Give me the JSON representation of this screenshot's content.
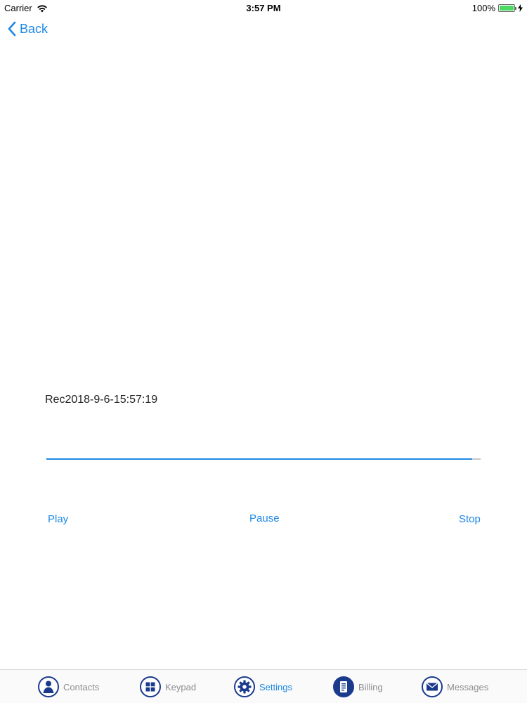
{
  "status_bar": {
    "carrier": "Carrier",
    "time": "3:57 PM",
    "battery": "100%",
    "battery_level": 1.0
  },
  "nav": {
    "back_label": "Back"
  },
  "recording": {
    "name": "Rec2018-9-6-15:57:19",
    "progress": 0.98
  },
  "controls": {
    "play": "Play",
    "pause": "Pause",
    "stop": "Stop"
  },
  "tabs": [
    {
      "label": "Contacts",
      "icon": "person-icon"
    },
    {
      "label": "Keypad",
      "icon": "grid-icon"
    },
    {
      "label": "Settings",
      "icon": "gear-icon",
      "active": true
    },
    {
      "label": "Billing",
      "icon": "document-icon"
    },
    {
      "label": "Messages",
      "icon": "envelope-icon"
    }
  ],
  "colors": {
    "accent": "#1e88e5",
    "tab_icon": "#1a3a8c",
    "battery": "#4cd964"
  }
}
